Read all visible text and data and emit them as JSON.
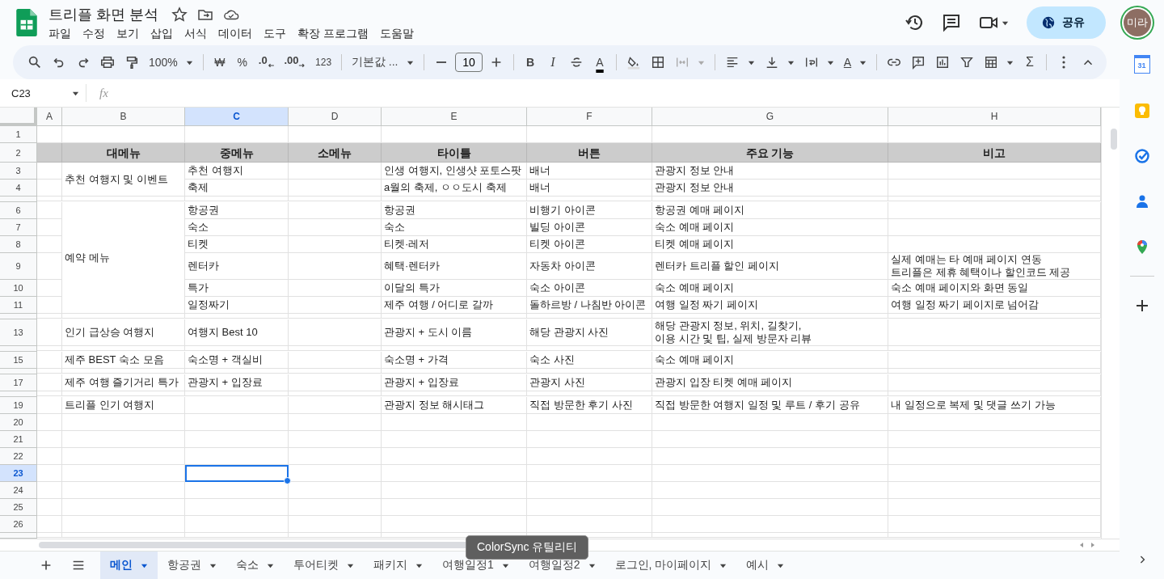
{
  "app": {
    "title": "트리플 화면 분석",
    "menu": [
      "파일",
      "수정",
      "보기",
      "삽입",
      "서식",
      "데이터",
      "도구",
      "확장 프로그램",
      "도움말"
    ],
    "share": "공유",
    "avatar": "미라"
  },
  "toolbar": {
    "zoom": "100%",
    "currency": "₩",
    "percent": "%",
    "decrease_decimal": ".0",
    "increase_decimal": ".00",
    "number_format": "123",
    "font": "기본값 ...",
    "font_size": "10",
    "bold": "B",
    "italic": "I",
    "text_color": "A",
    "text_rotation": "A",
    "functions": "Σ"
  },
  "formula_bar": {
    "name_box": "C23",
    "fx": "fx"
  },
  "side_panel": {
    "calendar_date": "31"
  },
  "sheet": {
    "columns": [
      {
        "letter": "A",
        "selected": false
      },
      {
        "letter": "B",
        "selected": false
      },
      {
        "letter": "C",
        "selected": true
      },
      {
        "letter": "D",
        "selected": false
      },
      {
        "letter": "E",
        "selected": false
      },
      {
        "letter": "F",
        "selected": false
      },
      {
        "letter": "G",
        "selected": false
      },
      {
        "letter": "H",
        "selected": false
      }
    ],
    "rows": [
      {
        "number": "1",
        "kind": "normal",
        "selected": false
      },
      {
        "number": "2",
        "kind": "header",
        "selected": false,
        "cells": {
          "B": "대메뉴",
          "C": "중메뉴",
          "D": "소메뉴",
          "E": "타이틀",
          "F": "버튼",
          "G": "주요 기능",
          "H": "비고"
        }
      },
      {
        "kind": "merged_group",
        "merged_cells": {
          "B": "추천 여행지 및 이벤트"
        },
        "rows": [
          {
            "number": "3",
            "kind": "normal",
            "selected": false,
            "cells": {
              "C": "추천 여행지",
              "E": "인생 여행지, 인생샷 포토스팟",
              "F": "배너",
              "G": "관광지 정보 안내"
            }
          },
          {
            "number": "4",
            "kind": "normal",
            "selected": false,
            "cells": {
              "C": "축제",
              "E": "a월의 축제, ㅇㅇ도시 축제",
              "F": "배너",
              "G": "관광지 정보 안내"
            }
          }
        ]
      },
      {
        "kind": "collapsed",
        "selected": false
      },
      {
        "kind": "merged_group",
        "merged_cells": {
          "B": "예약 메뉴"
        },
        "rows": [
          {
            "number": "6",
            "kind": "normal",
            "selected": false,
            "cells": {
              "C": "항공권",
              "E": "항공권",
              "F": "비행기 아이콘",
              "G": "항공권 예매 페이지"
            }
          },
          {
            "number": "7",
            "kind": "normal",
            "selected": false,
            "cells": {
              "C": "숙소",
              "E": "숙소",
              "F": "빌딩 아이콘",
              "G": "숙소 예매 페이지"
            }
          },
          {
            "number": "8",
            "kind": "normal",
            "selected": false,
            "cells": {
              "C": "티켓",
              "E": "티켓·레저",
              "F": "티켓 아이콘",
              "G": "티켓 예매 페이지"
            }
          },
          {
            "number": "9",
            "kind": "normal",
            "selected": false,
            "cells": {
              "C": "렌터카",
              "E": "혜택·렌터카",
              "F": "자동차 아이콘",
              "G": "렌터카 트리플 할인 페이지",
              "H": "실제 예매는 타 예매 페이지 연동\n트리플은 제휴 혜택이나 할인코드 제공"
            }
          },
          {
            "number": "10",
            "kind": "normal",
            "selected": false,
            "cells": {
              "C": "특가",
              "E": "이달의 특가",
              "F": "숙소 아이콘",
              "G": "숙소 예매 페이지",
              "H": "숙소 예매 페이지와 화면 동일"
            }
          },
          {
            "number": "11",
            "kind": "normal",
            "selected": false,
            "cells": {
              "C": "일정짜기",
              "E": "제주 여행 / 어디로 갈까",
              "F": "돌하르방 / 나침반 아이콘",
              "G": "여행 일정 짜기 페이지",
              "H": "여행 일정 짜기 페이지로 넘어감"
            }
          }
        ]
      },
      {
        "kind": "collapsed",
        "selected": false
      },
      {
        "number": "13",
        "kind": "normal",
        "selected": false,
        "cells": {
          "B": "인기 급상승 여행지",
          "C": "여행지 Best 10",
          "E": "관광지 + 도시 이름",
          "F": "해당 관광지 사진",
          "G": "해당 관광지 정보, 위치, 길찾기,\n이용 시간 및 팁, 실제 방문자 리뷰"
        }
      },
      {
        "kind": "collapsed",
        "selected": false
      },
      {
        "number": "15",
        "kind": "normal",
        "selected": false,
        "cells": {
          "B": "제주 BEST 숙소 모음",
          "C": "숙소명 + 객실비",
          "E": "숙소명 + 가격",
          "F": "숙소 사진",
          "G": "숙소 예매 페이지"
        }
      },
      {
        "kind": "collapsed",
        "selected": false
      },
      {
        "number": "17",
        "kind": "normal",
        "selected": false,
        "cells": {
          "B": "제주 여행 즐기거리 특가",
          "C": "관광지 + 입장료",
          "E": "관광지 + 입장료",
          "F": "관광지 사진",
          "G": "관광지 입장 티켓 예매 페이지"
        }
      },
      {
        "kind": "collapsed",
        "selected": false
      },
      {
        "number": "19",
        "kind": "normal",
        "selected": false,
        "cells": {
          "B": "트리플 인기 여행지",
          "E": "관광지 정보 해시태그",
          "F": "직접 방문한 후기 사진",
          "G": "직접 방문한 여행지 일정 및 루트 / 후기 공유",
          "H": "내 일정으로 복제 및 댓글 쓰기 가능"
        }
      },
      {
        "number": "20",
        "kind": "normal",
        "selected": false
      },
      {
        "number": "21",
        "kind": "normal",
        "selected": false
      },
      {
        "number": "22",
        "kind": "normal",
        "selected": false
      },
      {
        "number": "23",
        "kind": "normal",
        "selected": true
      },
      {
        "number": "24",
        "kind": "normal",
        "selected": false
      },
      {
        "number": "25",
        "kind": "normal",
        "selected": false
      },
      {
        "number": "26",
        "kind": "normal",
        "selected": false
      },
      {
        "kind": "collapsed",
        "selected": false
      }
    ]
  },
  "sheet_tabs": [
    {
      "label": "메인",
      "selected": true
    },
    {
      "label": "항공권",
      "selected": false
    },
    {
      "label": "숙소",
      "selected": false
    },
    {
      "label": "투어티켓",
      "selected": false
    },
    {
      "label": "패키지",
      "selected": false
    },
    {
      "label": "여행일정1",
      "selected": false
    },
    {
      "label": "여행일정2",
      "selected": false
    },
    {
      "label": "로그인, 마이페이지",
      "selected": false
    },
    {
      "label": "예시",
      "selected": false
    }
  ],
  "tooltip": "ColorSync 유틸리티"
}
